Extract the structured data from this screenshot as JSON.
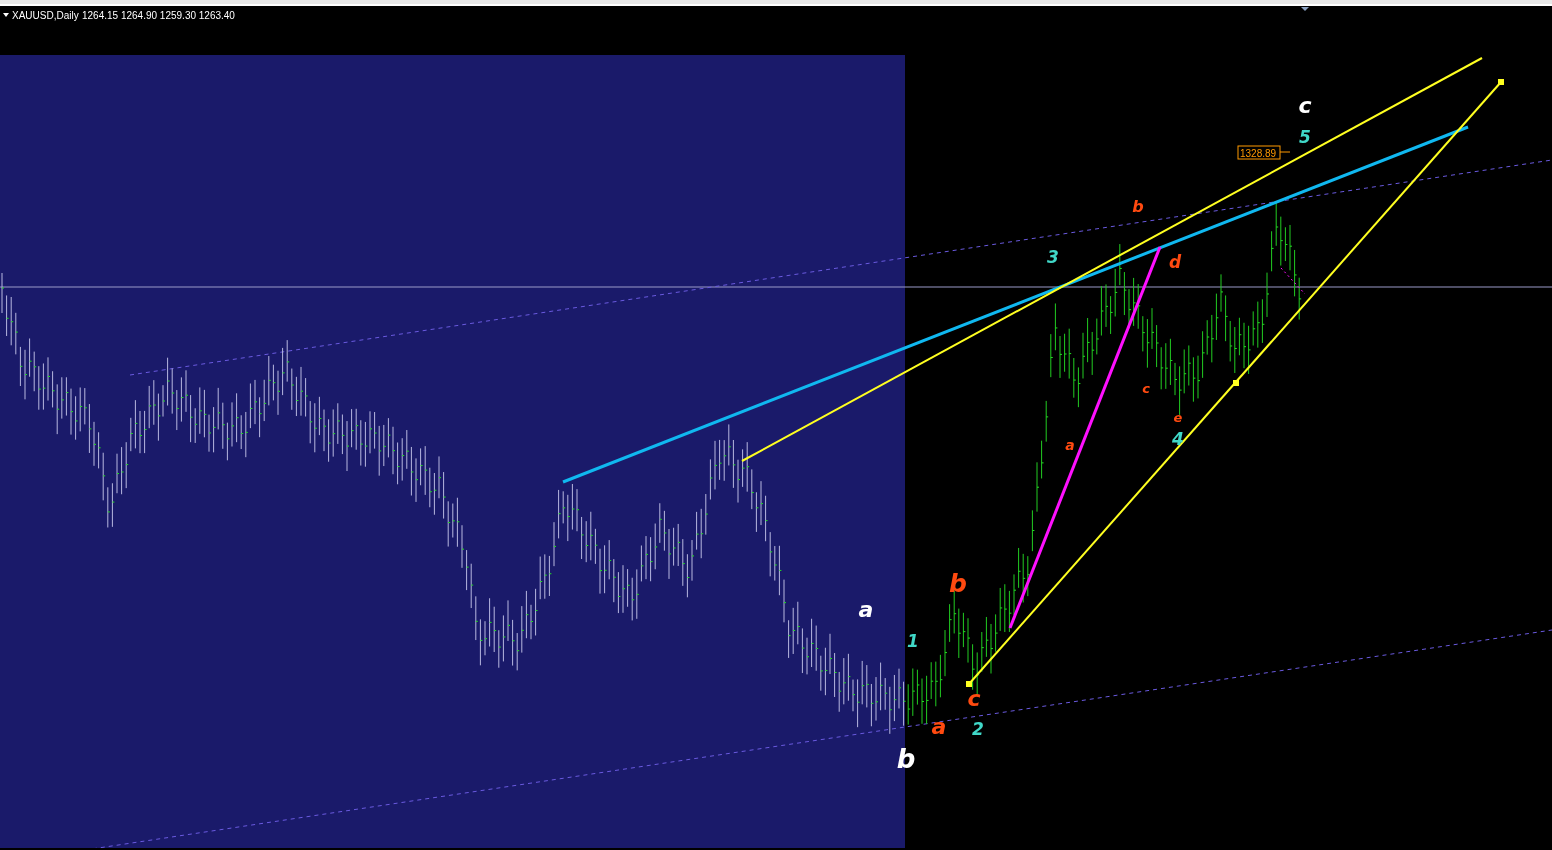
{
  "chart": {
    "symbol": "XAUUSD,Daily",
    "ohlc": "1264.15 1264.90 1259.30 1263.40",
    "price_label": "1328.89",
    "wave_labels": [
      {
        "text": "c",
        "color": "#ffffff"
      },
      {
        "text": "5",
        "color": "#40d8c8"
      },
      {
        "text": "b",
        "color": "#ff4a10"
      },
      {
        "text": "3",
        "color": "#40d8c8"
      },
      {
        "text": "d",
        "color": "#ff4a10"
      },
      {
        "text": "c",
        "color": "#ff4a10"
      },
      {
        "text": "e",
        "color": "#ff4a10"
      },
      {
        "text": "4",
        "color": "#40d8c8"
      },
      {
        "text": "a",
        "color": "#ff4a10"
      },
      {
        "text": "a",
        "color": "#ffffff"
      },
      {
        "text": "b",
        "color": "#ff4a10"
      },
      {
        "text": "1",
        "color": "#40d8c8"
      },
      {
        "text": "c",
        "color": "#ff4a10"
      },
      {
        "text": "a",
        "color": "#ff4a10"
      },
      {
        "text": "2",
        "color": "#40d8c8"
      },
      {
        "text": "b",
        "color": "#ffffff"
      }
    ]
  }
}
